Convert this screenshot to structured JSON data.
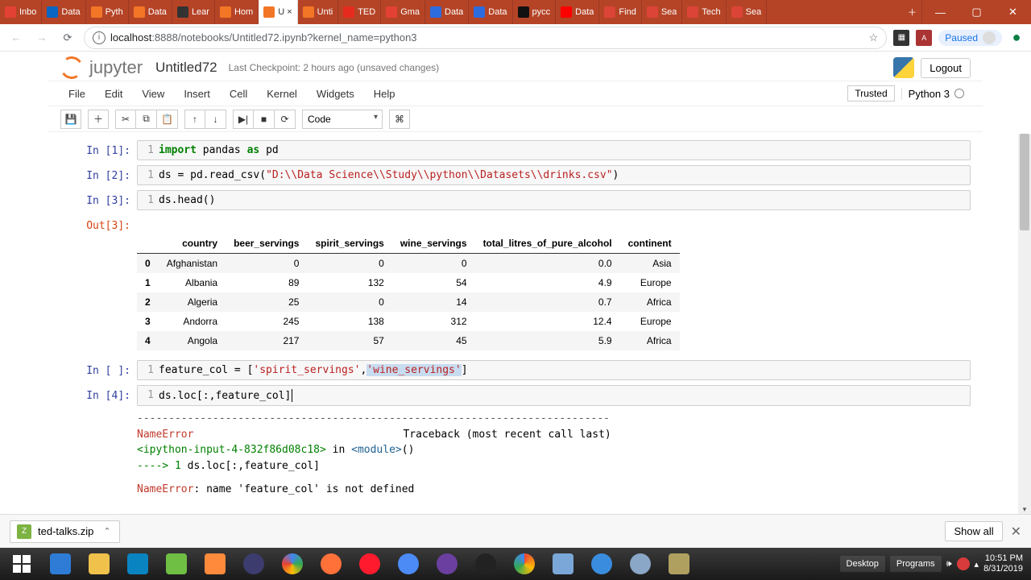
{
  "window": {
    "minimize": "—",
    "maximize": "▢",
    "close": "✕"
  },
  "browser_tabs": [
    {
      "label": "Inbo",
      "color": "#e34133",
      "active": false
    },
    {
      "label": "Data",
      "color": "#0a66c2",
      "active": false
    },
    {
      "label": "Pyth",
      "color": "#f37626",
      "active": false
    },
    {
      "label": "Data",
      "color": "#f37626",
      "active": false
    },
    {
      "label": "Lear",
      "color": "#333",
      "active": false
    },
    {
      "label": "Hom",
      "color": "#f37626",
      "active": false
    },
    {
      "label": "U ×",
      "color": "#f37626",
      "active": true
    },
    {
      "label": "Unti",
      "color": "#f37626",
      "active": false
    },
    {
      "label": "TED",
      "color": "#e62b1e",
      "active": false
    },
    {
      "label": "Gma",
      "color": "#e34133",
      "active": false
    },
    {
      "label": "Data",
      "color": "#2d6cdf",
      "active": false
    },
    {
      "label": "Data",
      "color": "#2d6cdf",
      "active": false
    },
    {
      "label": "pycc",
      "color": "#111",
      "active": false
    },
    {
      "label": "Data",
      "color": "#ff0000",
      "active": false
    },
    {
      "label": "Find",
      "color": "#db4437",
      "active": false
    },
    {
      "label": "Sea",
      "color": "#db4437",
      "active": false
    },
    {
      "label": "Tech",
      "color": "#db4437",
      "active": false
    },
    {
      "label": "Sea",
      "color": "#db4437",
      "active": false
    }
  ],
  "addressbar": {
    "url_prefix": "localhost",
    "url_rest": ":8888/notebooks/Untitled72.ipynb?kernel_name=python3",
    "paused": "Paused",
    "star": "☆"
  },
  "header": {
    "brand": "jupyter",
    "title": "Untitled72",
    "checkpoint": "Last Checkpoint: 2 hours ago (unsaved changes)",
    "logout": "Logout"
  },
  "menus": [
    "File",
    "Edit",
    "View",
    "Insert",
    "Cell",
    "Kernel",
    "Widgets",
    "Help"
  ],
  "trusted": "Trusted",
  "kernel": "Python 3",
  "cell_type": "Code",
  "toolbar_icons": [
    "💾",
    "＋",
    "✂",
    "⧉",
    "📋",
    "↑",
    "↓",
    "▶|",
    "■",
    "⟳",
    "⌘"
  ],
  "cells": {
    "c1": {
      "prompt": "In [1]:",
      "gutter": "1"
    },
    "c2": {
      "prompt": "In [2]:",
      "gutter": "1"
    },
    "c3": {
      "prompt": "In [3]:",
      "gutter": "1",
      "out": "Out[3]:"
    },
    "c4": {
      "prompt": "In [ ]:",
      "gutter": "1"
    },
    "c5": {
      "prompt": "In [4]:",
      "gutter": "1"
    }
  },
  "code": {
    "c1_import": "import",
    "c1_rest": " pandas ",
    "c1_as": "as",
    "c1_pd": " pd",
    "c2_pre": "ds = pd.read_csv(",
    "c2_str": "\"D:\\\\Data Science\\\\Study\\\\python\\\\Datasets\\\\drinks.csv\"",
    "c2_post": ")",
    "c3": "ds.head()",
    "c4_pre": "feature_col = [",
    "c4_s1": "'spirit_servings'",
    "c4_comma": ",",
    "c4_s2": "'wine_servings'",
    "c4_post": "]",
    "c5": "ds.loc[:,feature_col]"
  },
  "table": {
    "columns": [
      "",
      "country",
      "beer_servings",
      "spirit_servings",
      "wine_servings",
      "total_litres_of_pure_alcohol",
      "continent"
    ],
    "rows": [
      [
        "0",
        "Afghanistan",
        "0",
        "0",
        "0",
        "0.0",
        "Asia"
      ],
      [
        "1",
        "Albania",
        "89",
        "132",
        "54",
        "4.9",
        "Europe"
      ],
      [
        "2",
        "Algeria",
        "25",
        "0",
        "14",
        "0.7",
        "Africa"
      ],
      [
        "3",
        "Andorra",
        "245",
        "138",
        "312",
        "12.4",
        "Europe"
      ],
      [
        "4",
        "Angola",
        "217",
        "57",
        "45",
        "5.9",
        "Africa"
      ]
    ]
  },
  "traceback": {
    "dashes": "---------------------------------------------------------------------------",
    "err": "NameError",
    "tb": "Traceback (most recent call last)",
    "frame_pre": "<ipython-input-4-832f86d08c18>",
    "frame_in": " in ",
    "frame_mod": "<module>",
    "frame_paren": "()",
    "arrow": "----> 1 ",
    "arrow_code": "ds.loc[:,feature_col]",
    "final_err": "NameError",
    "final_msg": ": name 'feature_col' is not defined"
  },
  "downloads": {
    "file": "ted-talks.zip",
    "showall": "Show all"
  },
  "tray": {
    "desktop": "Desktop",
    "programs": "Programs",
    "time": "10:51 PM",
    "date": "8/31/2019"
  }
}
